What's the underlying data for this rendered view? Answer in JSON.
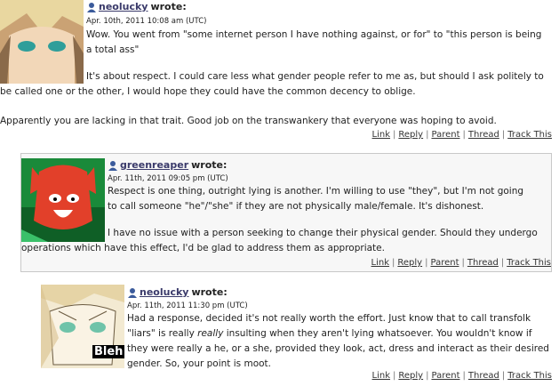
{
  "comments": [
    {
      "author": "neolucky",
      "wrote": "wrote:",
      "date": "Apr. 10th, 2011 10:08 am (UTC)",
      "paragraphs": [
        "Wow. You went from \"some internet person I have nothing against, or for\" to \"this person is being a total ass\"",
        "It's about respect. I could care less what gender people refer to me as, but should I ask politely to be called one or the other, I would hope they could have the common decency to oblige.",
        "Apparently you are lacking in that trait. Good job on the transwankery that everyone was hoping to avoid."
      ],
      "actions": [
        "Link",
        "Reply",
        "Parent",
        "Thread",
        "Track This"
      ]
    },
    {
      "author": "greenreaper",
      "wrote": "wrote:",
      "date": "Apr. 11th, 2011 09:05 pm (UTC)",
      "paragraphs": [
        "Respect is one thing, outright lying is another. I'm willing to use \"they\", but I'm not going to call someone \"he\"/\"she\" if they are not physically male/female. It's dishonest.",
        "I have no issue with a person seeking to change their physical gender. Should they undergo operations which have this effect, I'd be glad to address them as appropriate."
      ],
      "actions": [
        "Link",
        "Reply",
        "Parent",
        "Thread",
        "Track This"
      ]
    },
    {
      "author": "neolucky",
      "wrote": "wrote:",
      "date": "Apr. 11th, 2011 11:30 pm (UTC)",
      "paragraphs": [
        "Had a response, decided it's not really worth the effort. Just know that to call transfolk \"liars\" is really ",
        "really",
        " insulting when they aren't lying whatsoever. You wouldn't know if they were really a he, or a she, provided they look, act, dress and interact as their desired gender. So, your point is moot."
      ],
      "avatar_text": "Bleh!",
      "actions": [
        "Link",
        "Reply",
        "Parent",
        "Thread",
        "Track This"
      ]
    }
  ],
  "icons": {
    "user": "user-icon"
  }
}
